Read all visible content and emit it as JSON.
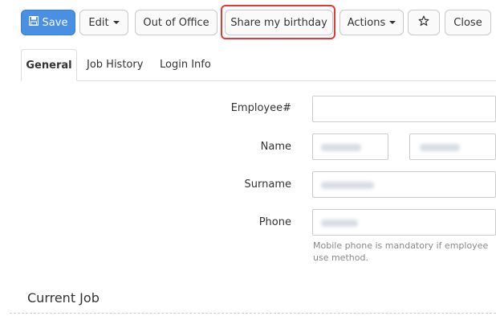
{
  "toolbar": {
    "save_label": "Save",
    "edit_label": "Edit",
    "out_of_office_label": "Out of Office",
    "share_birthday_label": "Share my birthday",
    "actions_label": "Actions",
    "close_label": "Close"
  },
  "tabs": [
    {
      "label": "General",
      "active": true
    },
    {
      "label": "Job History",
      "active": false
    },
    {
      "label": "Login Info",
      "active": false
    }
  ],
  "form": {
    "employee_no_label": "Employee#",
    "name_label": "Name",
    "surname_label": "Surname",
    "phone_label": "Phone",
    "phone_help": "Mobile phone is mandatory if employee use method."
  },
  "sections": {
    "current_job": "Current Job"
  },
  "colors": {
    "primary": "#4a90e2",
    "highlight": "#e53935"
  }
}
